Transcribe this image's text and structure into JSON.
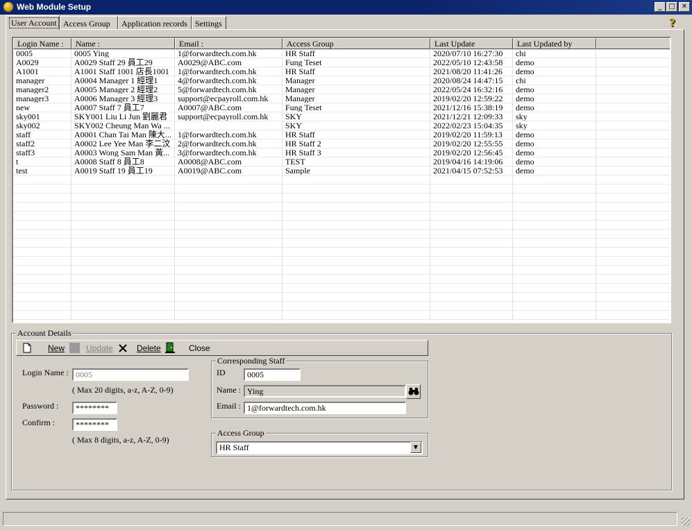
{
  "window": {
    "title": "Web Module Setup"
  },
  "tabs": [
    {
      "label": "User Account"
    },
    {
      "label": "Access Group"
    },
    {
      "label": "Application records"
    },
    {
      "label": "Settings"
    }
  ],
  "grid": {
    "columns": [
      "Login Name :",
      "Name :",
      "Email :",
      "Access Group",
      "Last Update",
      "Last Updated by",
      ""
    ],
    "rows": [
      [
        "0005",
        "0005 Ying",
        "1@forwardtech.com.hk",
        "HR Staff",
        "2020/07/10 16:27:30",
        "chi"
      ],
      [
        "A0029",
        "A0029 Staff 29 員工29",
        "A0029@ABC.com",
        "Fung Teset",
        "2022/05/10 12:43:58",
        "demo"
      ],
      [
        "A1001",
        "A1001 Staff 1001 店長1001",
        "1@forwardtech.com.hk",
        "HR Staff",
        "2021/08/20 11:41:26",
        "demo"
      ],
      [
        "manager",
        "A0004 Manager 1 經理1",
        "4@forwardtech.com.hk",
        "Manager",
        "2020/08/24 14:47:15",
        "chi"
      ],
      [
        "manager2",
        "A0005 Manager 2 經理2",
        "5@forwardtech.com.hk",
        "Manager",
        "2022/05/24 16:32:16",
        "demo"
      ],
      [
        "manager3",
        "A0006 Manager 3 經理3",
        "support@ecpayroll.com.hk",
        "Manager",
        "2019/02/20 12:59:22",
        "demo"
      ],
      [
        "new",
        "A0007 Staff 7 員工7",
        "A0007@ABC.com",
        "Fung Teset",
        "2021/12/16 15:38:19",
        "demo"
      ],
      [
        "sky001",
        "SKY001 Liu Li Jun 劉麗君",
        "support@ecpayroll.com.hk",
        "SKY",
        "2021/12/21 12:09:33",
        "sky"
      ],
      [
        "sky002",
        "SKY002 Cheung Man Wa ...",
        "",
        "SKY",
        "2022/02/23 15:04:35",
        "sky"
      ],
      [
        "staff",
        "A0001 Chan Tai Man 陳大...",
        "1@forwardtech.com.hk",
        "HR Staff",
        "2019/02/20 11:59:13",
        "demo"
      ],
      [
        "staff2",
        "A0002 Lee Yee Man 李二汶",
        "2@forwardtech.com.hk",
        "HR Staff 2",
        "2019/02/20 12:55:55",
        "demo"
      ],
      [
        "staff3",
        "A0003 Wong Sam Man 黃...",
        "3@forwardtech.com.hk",
        "HR Staff 3",
        "2019/02/20 12:56:45",
        "demo"
      ],
      [
        "t",
        "A0008 Staff 8 員工8",
        "A0008@ABC.com",
        "TEST",
        "2019/04/16 14:19:06",
        "demo"
      ],
      [
        "test",
        "A0019 Staff 19 員工19",
        "A0019@ABC.com",
        "Sample",
        "2021/04/15 07:52:53",
        "demo"
      ]
    ]
  },
  "details": {
    "legend": "Account Details",
    "toolbar": {
      "new": "New",
      "update": "Update",
      "delete": "Delete",
      "close": "Close"
    },
    "login_label": "Login Name :",
    "login_value": "0005",
    "login_hint": "( Max 20 digits,  a-z, A-Z, 0-9)",
    "password_label": "Password :",
    "password_value": "********",
    "confirm_label": "Confirm :",
    "confirm_value": "********",
    "password_hint": "( Max 8 digits,  a-z, A-Z, 0-9)",
    "staff": {
      "legend": "Corresponding Staff",
      "id_label": "ID",
      "id_value": "0005",
      "name_label": "Name :",
      "name_value": "Ying",
      "email_label": "Email :",
      "email_value": "1@forwardtech.com.hk"
    },
    "access": {
      "legend": "Access Group",
      "value": "HR Staff"
    }
  }
}
